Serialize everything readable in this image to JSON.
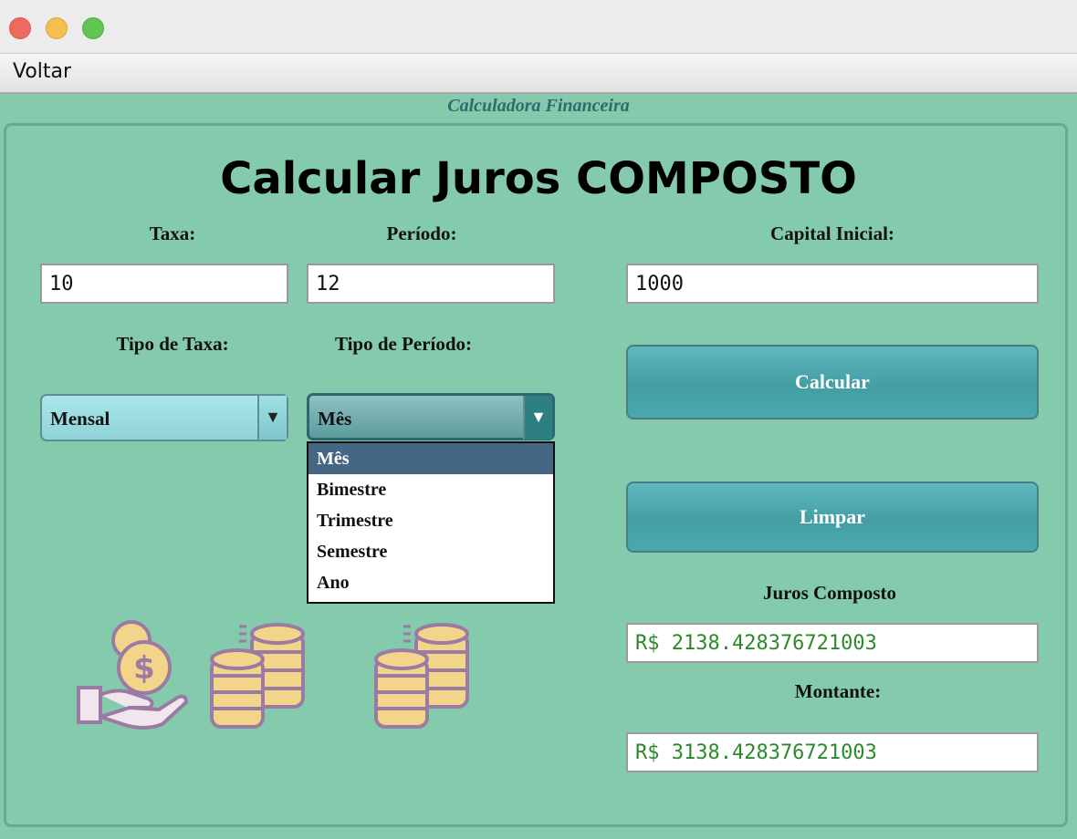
{
  "menu": {
    "voltar": "Voltar"
  },
  "frame_title": "Calculadora Financeira",
  "heading": "Calcular Juros COMPOSTO",
  "taxa": {
    "label": "Taxa:",
    "value": "10"
  },
  "periodo": {
    "label": "Período:",
    "value": "12"
  },
  "capital": {
    "label": "Capital Inicial:",
    "value": "1000"
  },
  "tipo_taxa": {
    "label": "Tipo de Taxa:",
    "selected": "Mensal"
  },
  "tipo_periodo": {
    "label": "Tipo de Período:",
    "selected": "Mês",
    "options": [
      "Mês",
      "Bimestre",
      "Trimestre",
      "Semestre",
      "Ano"
    ]
  },
  "buttons": {
    "calcular": "Calcular",
    "limpar": "Limpar"
  },
  "juros": {
    "label": "Juros Composto",
    "value": "R$ 2138.428376721003"
  },
  "montante": {
    "label": "Montante:",
    "value": "R$ 3138.428376721003"
  },
  "icons": [
    "hand-money-icon",
    "coin-stacks-icon",
    "coin-stacks-icon"
  ]
}
